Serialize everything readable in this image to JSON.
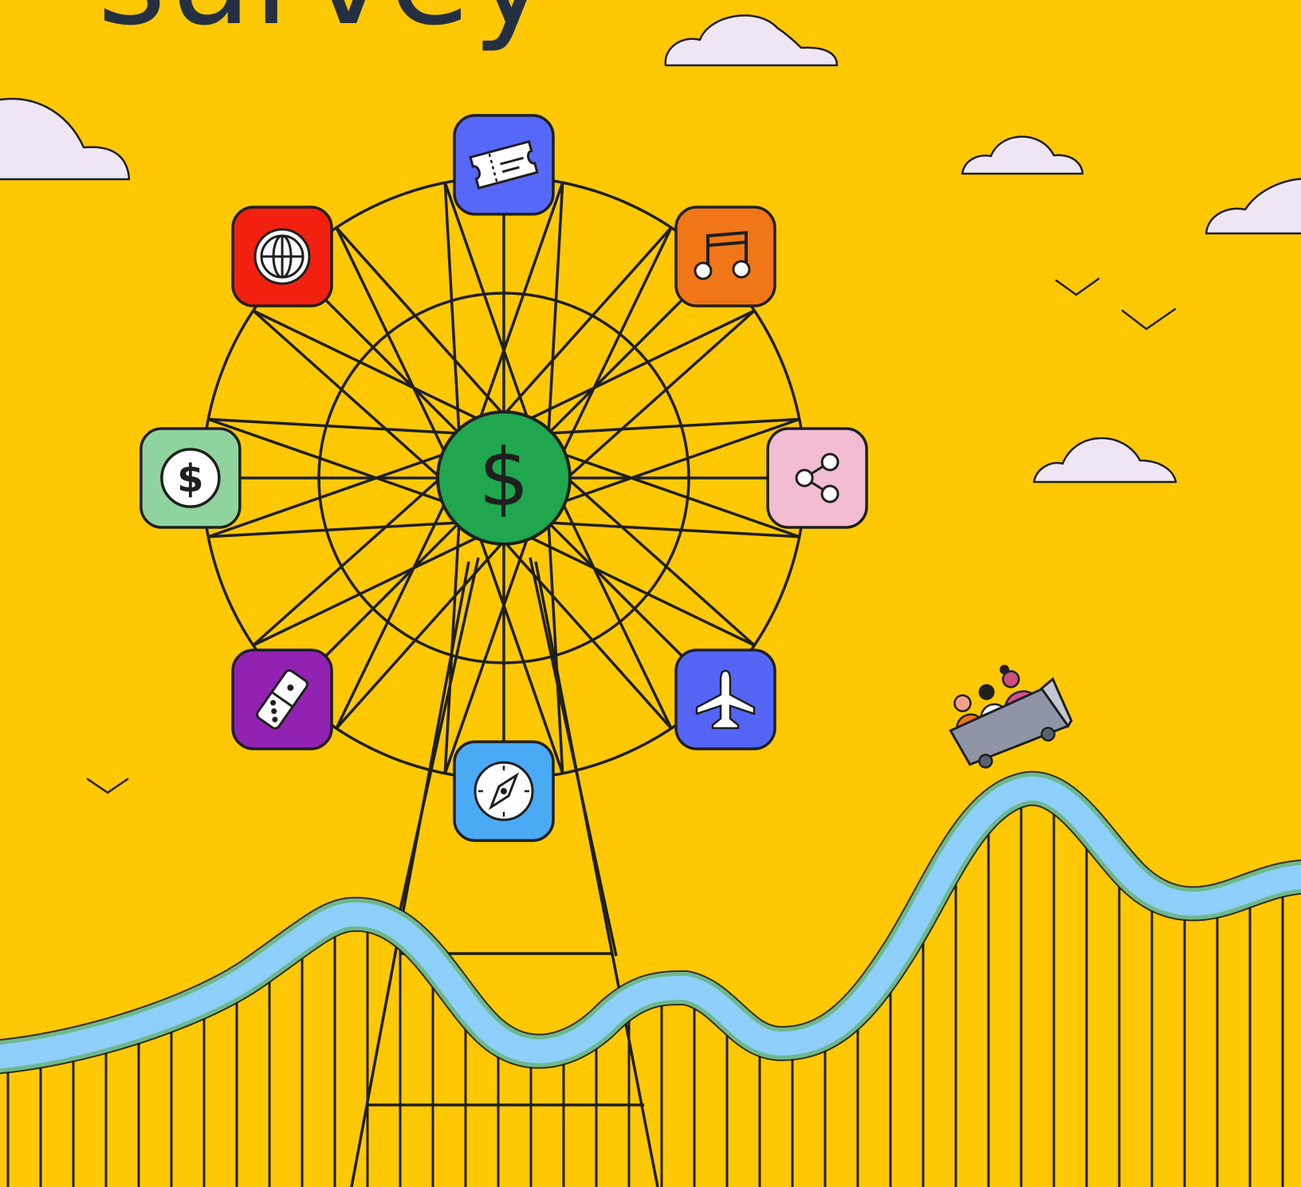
{
  "headline": "survey",
  "colors": {
    "background": "#FFC805",
    "outline": "#1F1F1F",
    "title": "#243041",
    "cloud": "#EEE6F4",
    "track_fill": "#8ECFFB",
    "track_edge": "#6FB88C",
    "hub": "#1FA64E"
  },
  "wheel_icons": [
    {
      "name": "ticket-icon",
      "color": "#5668F7"
    },
    {
      "name": "music-note-icon",
      "color": "#F07618"
    },
    {
      "name": "share-icon",
      "color": "#F2BCD3"
    },
    {
      "name": "airplane-icon",
      "color": "#5465F5"
    },
    {
      "name": "compass-icon",
      "color": "#4AAAF3"
    },
    {
      "name": "domino-icon",
      "color": "#9223B2"
    },
    {
      "name": "dollar-coin-icon",
      "color": "#8FD49E"
    },
    {
      "name": "globe-icon",
      "color": "#F2200F"
    }
  ],
  "hub_icon": {
    "name": "dollar-sign-icon",
    "glyph": "$"
  },
  "coin_glyph": "$"
}
